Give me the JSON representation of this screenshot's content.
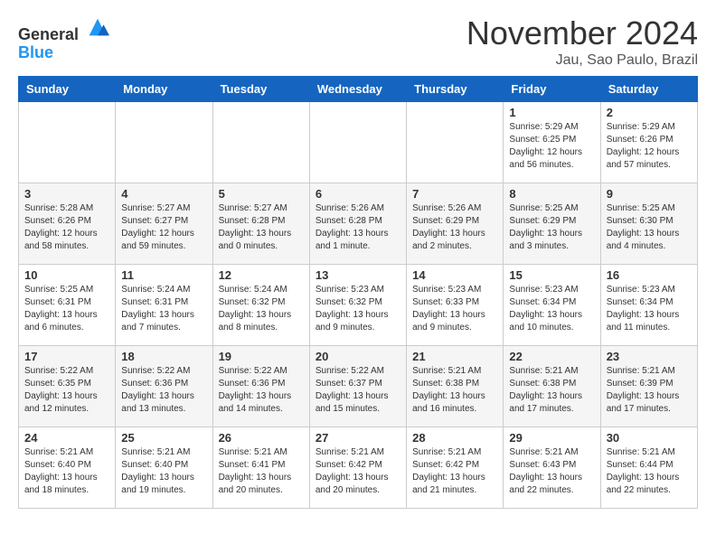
{
  "header": {
    "logo_general": "General",
    "logo_blue": "Blue",
    "month_title": "November 2024",
    "location": "Jau, Sao Paulo, Brazil"
  },
  "weekdays": [
    "Sunday",
    "Monday",
    "Tuesday",
    "Wednesday",
    "Thursday",
    "Friday",
    "Saturday"
  ],
  "weeks": [
    [
      {
        "day": "",
        "info": ""
      },
      {
        "day": "",
        "info": ""
      },
      {
        "day": "",
        "info": ""
      },
      {
        "day": "",
        "info": ""
      },
      {
        "day": "",
        "info": ""
      },
      {
        "day": "1",
        "info": "Sunrise: 5:29 AM\nSunset: 6:25 PM\nDaylight: 12 hours and 56 minutes."
      },
      {
        "day": "2",
        "info": "Sunrise: 5:29 AM\nSunset: 6:26 PM\nDaylight: 12 hours and 57 minutes."
      }
    ],
    [
      {
        "day": "3",
        "info": "Sunrise: 5:28 AM\nSunset: 6:26 PM\nDaylight: 12 hours and 58 minutes."
      },
      {
        "day": "4",
        "info": "Sunrise: 5:27 AM\nSunset: 6:27 PM\nDaylight: 12 hours and 59 minutes."
      },
      {
        "day": "5",
        "info": "Sunrise: 5:27 AM\nSunset: 6:28 PM\nDaylight: 13 hours and 0 minutes."
      },
      {
        "day": "6",
        "info": "Sunrise: 5:26 AM\nSunset: 6:28 PM\nDaylight: 13 hours and 1 minute."
      },
      {
        "day": "7",
        "info": "Sunrise: 5:26 AM\nSunset: 6:29 PM\nDaylight: 13 hours and 2 minutes."
      },
      {
        "day": "8",
        "info": "Sunrise: 5:25 AM\nSunset: 6:29 PM\nDaylight: 13 hours and 3 minutes."
      },
      {
        "day": "9",
        "info": "Sunrise: 5:25 AM\nSunset: 6:30 PM\nDaylight: 13 hours and 4 minutes."
      }
    ],
    [
      {
        "day": "10",
        "info": "Sunrise: 5:25 AM\nSunset: 6:31 PM\nDaylight: 13 hours and 6 minutes."
      },
      {
        "day": "11",
        "info": "Sunrise: 5:24 AM\nSunset: 6:31 PM\nDaylight: 13 hours and 7 minutes."
      },
      {
        "day": "12",
        "info": "Sunrise: 5:24 AM\nSunset: 6:32 PM\nDaylight: 13 hours and 8 minutes."
      },
      {
        "day": "13",
        "info": "Sunrise: 5:23 AM\nSunset: 6:32 PM\nDaylight: 13 hours and 9 minutes."
      },
      {
        "day": "14",
        "info": "Sunrise: 5:23 AM\nSunset: 6:33 PM\nDaylight: 13 hours and 9 minutes."
      },
      {
        "day": "15",
        "info": "Sunrise: 5:23 AM\nSunset: 6:34 PM\nDaylight: 13 hours and 10 minutes."
      },
      {
        "day": "16",
        "info": "Sunrise: 5:23 AM\nSunset: 6:34 PM\nDaylight: 13 hours and 11 minutes."
      }
    ],
    [
      {
        "day": "17",
        "info": "Sunrise: 5:22 AM\nSunset: 6:35 PM\nDaylight: 13 hours and 12 minutes."
      },
      {
        "day": "18",
        "info": "Sunrise: 5:22 AM\nSunset: 6:36 PM\nDaylight: 13 hours and 13 minutes."
      },
      {
        "day": "19",
        "info": "Sunrise: 5:22 AM\nSunset: 6:36 PM\nDaylight: 13 hours and 14 minutes."
      },
      {
        "day": "20",
        "info": "Sunrise: 5:22 AM\nSunset: 6:37 PM\nDaylight: 13 hours and 15 minutes."
      },
      {
        "day": "21",
        "info": "Sunrise: 5:21 AM\nSunset: 6:38 PM\nDaylight: 13 hours and 16 minutes."
      },
      {
        "day": "22",
        "info": "Sunrise: 5:21 AM\nSunset: 6:38 PM\nDaylight: 13 hours and 17 minutes."
      },
      {
        "day": "23",
        "info": "Sunrise: 5:21 AM\nSunset: 6:39 PM\nDaylight: 13 hours and 17 minutes."
      }
    ],
    [
      {
        "day": "24",
        "info": "Sunrise: 5:21 AM\nSunset: 6:40 PM\nDaylight: 13 hours and 18 minutes."
      },
      {
        "day": "25",
        "info": "Sunrise: 5:21 AM\nSunset: 6:40 PM\nDaylight: 13 hours and 19 minutes."
      },
      {
        "day": "26",
        "info": "Sunrise: 5:21 AM\nSunset: 6:41 PM\nDaylight: 13 hours and 20 minutes."
      },
      {
        "day": "27",
        "info": "Sunrise: 5:21 AM\nSunset: 6:42 PM\nDaylight: 13 hours and 20 minutes."
      },
      {
        "day": "28",
        "info": "Sunrise: 5:21 AM\nSunset: 6:42 PM\nDaylight: 13 hours and 21 minutes."
      },
      {
        "day": "29",
        "info": "Sunrise: 5:21 AM\nSunset: 6:43 PM\nDaylight: 13 hours and 22 minutes."
      },
      {
        "day": "30",
        "info": "Sunrise: 5:21 AM\nSunset: 6:44 PM\nDaylight: 13 hours and 22 minutes."
      }
    ]
  ]
}
